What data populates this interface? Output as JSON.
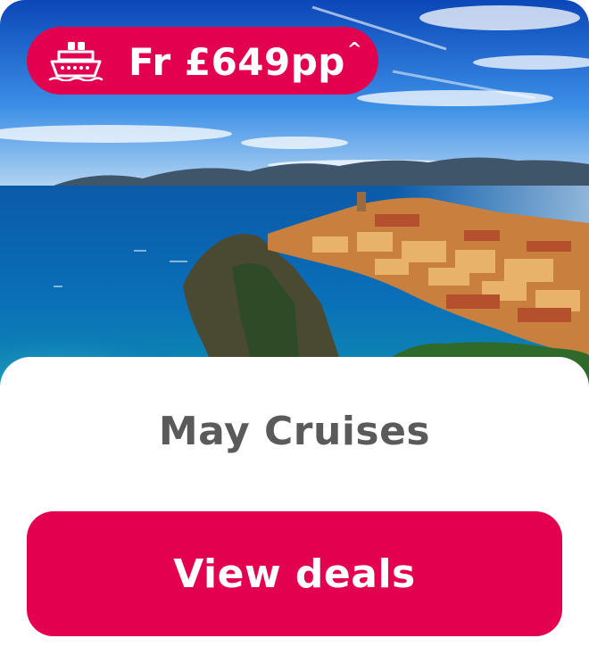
{
  "card": {
    "price_badge": {
      "icon": "cruise-ship-icon",
      "label": "Fr £649pp",
      "footnote_mark": "^"
    },
    "image": {
      "subject": "coastal-town-photo"
    },
    "title": "May Cruises",
    "cta_label": "View deals"
  },
  "colors": {
    "brand": "#e2004f",
    "title_text": "#5a5a5a",
    "background": "#ffffff"
  }
}
